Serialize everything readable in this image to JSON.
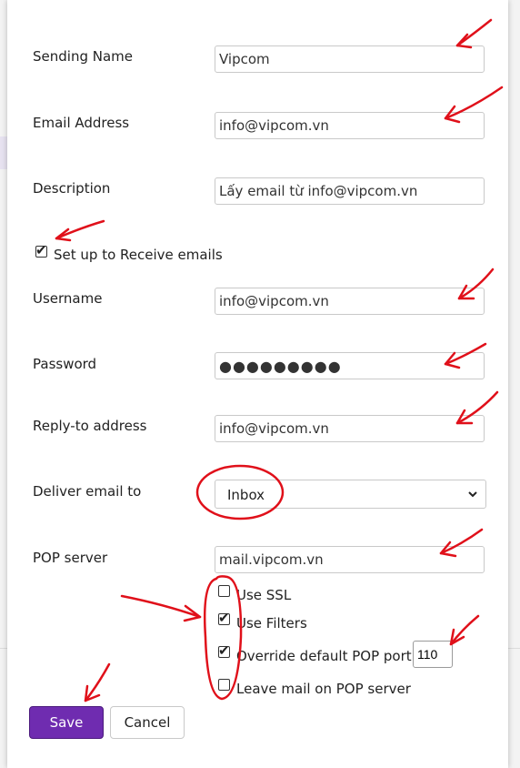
{
  "form": {
    "sending_name": {
      "label": "Sending Name",
      "value": "Vipcom"
    },
    "email_address": {
      "label": "Email Address",
      "value": "info@vipcom.vn"
    },
    "description": {
      "label": "Description",
      "value": "Lấy email từ info@vipcom.vn"
    },
    "receive_checkbox": {
      "label": "Set up to Receive emails",
      "checked": true
    },
    "username": {
      "label": "Username",
      "value": "info@vipcom.vn"
    },
    "password": {
      "label": "Password",
      "value": "●●●●●●●●●"
    },
    "reply_to": {
      "label": "Reply-to address",
      "value": "info@vipcom.vn"
    },
    "deliver_to": {
      "label": "Deliver email to",
      "selected": "Inbox"
    },
    "pop_server": {
      "label": "POP server",
      "value": "mail.vipcom.vn"
    },
    "options": {
      "use_ssl": {
        "label": "Use SSL",
        "checked": false
      },
      "use_filters": {
        "label": "Use Filters",
        "checked": true
      },
      "override_port": {
        "label": "Override default POP port",
        "checked": true,
        "port": "110"
      },
      "leave_mail": {
        "label": "Leave mail on POP server",
        "checked": false
      }
    }
  },
  "actions": {
    "save_label": "Save",
    "cancel_label": "Cancel"
  },
  "icons": {
    "checkmark": "✔",
    "chevron": "⌄"
  },
  "colors": {
    "primary_button": "#6f2cb0",
    "annotation": "#e0101a"
  }
}
